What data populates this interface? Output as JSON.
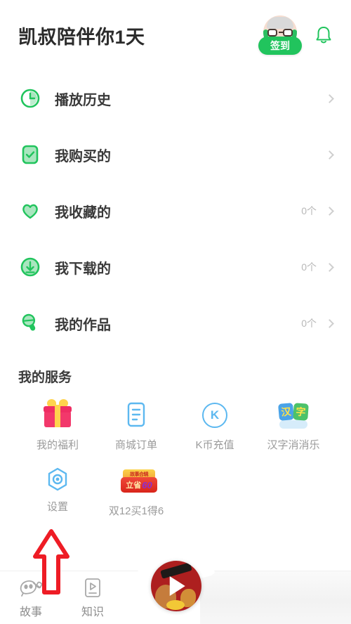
{
  "header": {
    "title": "凯叔陪伴你1天",
    "signin_label": "签到",
    "avatar_name": "avatar",
    "bell_name": "notification-bell"
  },
  "list": {
    "items": [
      {
        "label": "播放历史",
        "count": "",
        "icon": "clock-icon"
      },
      {
        "label": "我购买的",
        "count": "",
        "icon": "check-square-icon"
      },
      {
        "label": "我收藏的",
        "count": "0个",
        "icon": "heart-icon"
      },
      {
        "label": "我下载的",
        "count": "0个",
        "icon": "download-icon"
      },
      {
        "label": "我的作品",
        "count": "0个",
        "icon": "microphone-icon"
      }
    ]
  },
  "services": {
    "title": "我的服务",
    "items": [
      {
        "label": "我的福利",
        "icon": "gift-icon"
      },
      {
        "label": "商城订单",
        "icon": "order-document-icon"
      },
      {
        "label": "K币充值",
        "icon": "k-coin-icon"
      },
      {
        "label": "汉字消消乐",
        "icon": "hanzi-game-icon"
      },
      {
        "label": "设置",
        "icon": "settings-hexagon-icon"
      },
      {
        "label": "双12买1得6",
        "icon": "promo-badge-icon"
      }
    ],
    "promo_badge": {
      "top_text": "故事合辑",
      "main_text": "立省",
      "number": "60"
    },
    "hanzi_tiles": {
      "left": "汉",
      "right": "字"
    },
    "kcoin_letter": "K"
  },
  "bottom_nav": {
    "items": [
      {
        "label": "故事",
        "icon": "ghost-icon"
      },
      {
        "label": "知识",
        "icon": "play-box-icon"
      }
    ],
    "player_button": "floating-player-button"
  },
  "colors": {
    "green": "#21c45d",
    "green_light": "#a9e6bf",
    "blue": "#5cb8f0",
    "red_annotation": "#ee1c25",
    "text_primary": "#3a3a3a",
    "text_muted": "#9b9b9b"
  }
}
